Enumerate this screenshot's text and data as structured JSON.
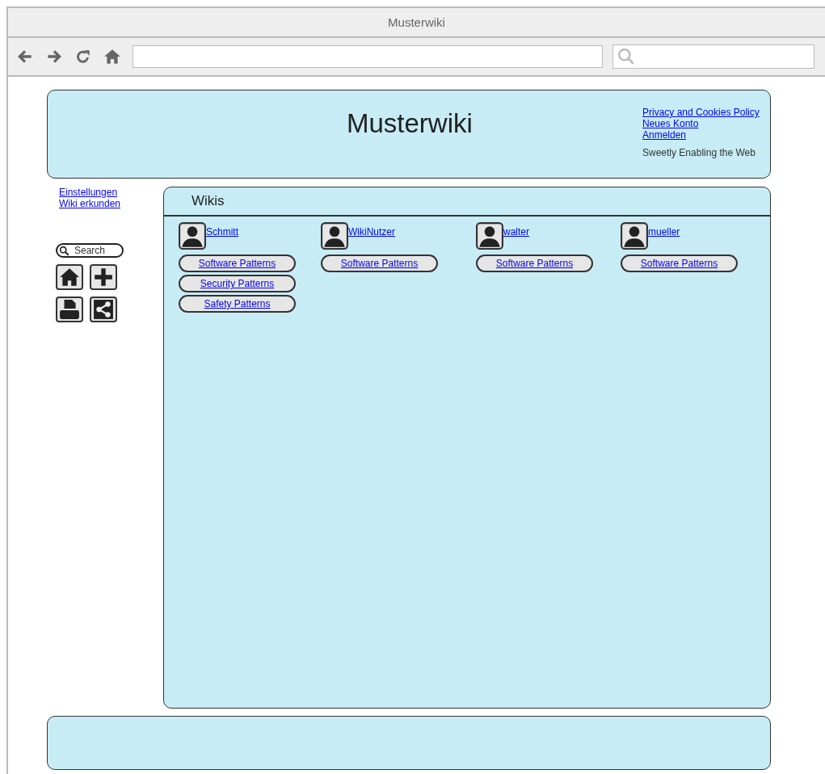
{
  "window": {
    "title": "Musterwiki"
  },
  "header": {
    "title": "Musterwiki",
    "links": [
      "Privacy and Cookies Policy",
      "Neues Konto",
      "Anmelden"
    ],
    "tagline": "Sweetly Enabling the Web"
  },
  "sidebar": {
    "links": [
      "Einstellungen",
      "Wiki erkunden"
    ],
    "search": {
      "placeholder": "Search"
    },
    "tools": [
      {
        "kind": "home"
      },
      {
        "kind": "add"
      },
      {
        "kind": "print"
      },
      {
        "kind": "share"
      }
    ]
  },
  "panel": {
    "title": "Wikis",
    "users": [
      {
        "name": "Schmitt",
        "wikis": [
          "Software Patterns",
          "Security Patterns",
          "Safety Patterns"
        ]
      },
      {
        "name": "WikiNutzer",
        "wikis": [
          "Software Patterns"
        ]
      },
      {
        "name": "walter",
        "wikis": [
          "Software Patterns"
        ]
      },
      {
        "name": "mueller",
        "wikis": [
          "Software Patterns"
        ]
      }
    ]
  }
}
